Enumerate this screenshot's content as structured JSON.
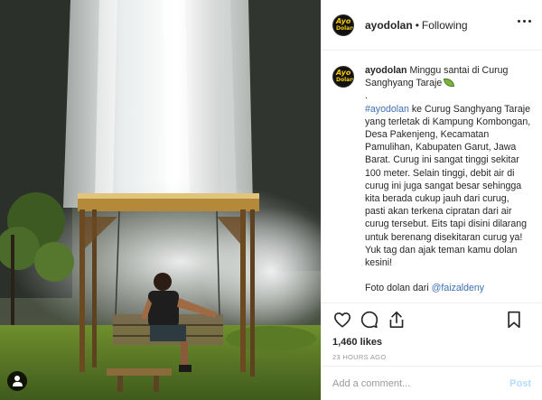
{
  "post": {
    "username": "ayodolan",
    "follow_separator": "•",
    "follow_status": "Following",
    "avatar_logo_line1": "Ayo",
    "avatar_logo_line2": "Dolan",
    "caption": {
      "title": "Minggu santai di Curug Sanghyang Taraje",
      "dot": ".",
      "hashtag": "#ayodolan",
      "body": " ke Curug Sanghyang Taraje yang terletak di Kampung Kombongan, Desa Pakenjeng, Kecamatan Pamulihan, Kabupaten Garut, Jawa Barat. Curug ini sangat tinggi sekitar 100 meter. Selain tinggi, debit air di curug ini juga sangat besar sehingga kita berada cukup jauh dari curug, pasti akan terkena cipratan dari air curug tersebut. Eits tapi disini dilarang untuk berenang disekitaran curug ya! Yuk tag dan ajak teman kamu dolan kesini!",
      "credit_prefix": "Foto dolan dari ",
      "credit_mention": "@faizaldeny"
    },
    "likes": "1,460 likes",
    "timestamp": "23 HOURS AGO",
    "comment_placeholder": "Add a comment...",
    "post_button": "Post"
  },
  "icons": {
    "like": "heart-icon",
    "comment": "comment-icon",
    "share": "share-icon",
    "save": "bookmark-icon",
    "more": "more-options-icon",
    "tag": "user-tag-icon"
  },
  "colors": {
    "link": "#3b6fb6",
    "post_button": "#b3dbff",
    "muted": "#999999",
    "border": "#efefef"
  }
}
